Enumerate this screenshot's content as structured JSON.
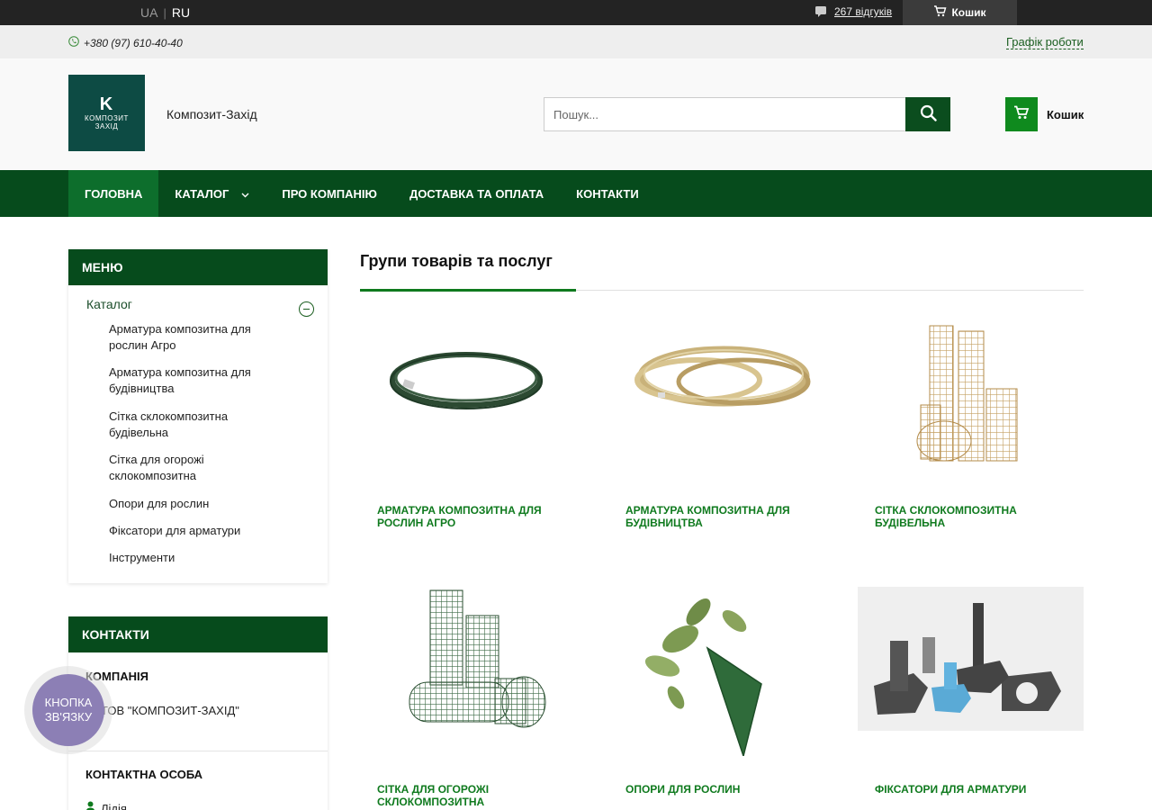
{
  "topbar": {
    "lang_ua": "UA",
    "lang_sep": "|",
    "lang_ru": "RU",
    "reviews": "267 відгуків",
    "cart": "Кошик"
  },
  "infobar": {
    "phone": "+380 (97) 610-40-40",
    "schedule": "Графік роботи"
  },
  "header": {
    "logo_letter": "K",
    "logo_line1": "КОМПОЗИТ",
    "logo_line2": "ЗАХІД",
    "company": "Композит-Захід",
    "search_placeholder": "Пошук...",
    "cart": "Кошик"
  },
  "nav": {
    "items": [
      {
        "label": "ГОЛОВНА",
        "active": true
      },
      {
        "label": "КАТАЛОГ",
        "dropdown": true
      },
      {
        "label": "ПРО КОМПАНІЮ"
      },
      {
        "label": "ДОСТАВКА ТА ОПЛАТА"
      },
      {
        "label": "КОНТАКТИ"
      }
    ]
  },
  "sidebar": {
    "menu_title": "МЕНЮ",
    "catalog": "Каталог",
    "items": [
      "Арматура композитна для рослин Агро",
      "Арматура композитна для будівництва",
      "Сітка склокомпозитна будівельна",
      "Сітка для огорожі склокомпозитна",
      "Опори для рослин",
      "Фіксатори для арматури",
      "Інструменти"
    ],
    "contacts_title": "КОНТАКТИ",
    "company_label": "КОМПАНІЯ",
    "company_name": "ТОВ \"КОМПОЗИТ-ЗАХІД\"",
    "person_label": "КОНТАКТНА ОСОБА",
    "person_name": "Лідія"
  },
  "float_button": {
    "line1": "КНОПКА",
    "line2": "ЗВ'ЯЗКУ"
  },
  "main": {
    "title": "Групи товарів та послуг",
    "groups": [
      "АРМАТУРА КОМПОЗИТНА ДЛЯ РОСЛИН АГРО",
      "АРМАТУРА КОМПОЗИТНА ДЛЯ БУДІВНИЦТВА",
      "СІТКА СКЛОКОМПОЗИТНА БУДІВЕЛЬНА",
      "СІТКА ДЛЯ ОГОРОЖІ СКЛОКОМПОЗИТНА",
      "ОПОРИ ДЛЯ РОСЛИН",
      "ФІКСАТОРИ ДЛЯ АРМАТУРИ"
    ]
  },
  "colors": {
    "nav_bg": "#064b1c",
    "nav_active": "#0d6e2c",
    "accent": "#0f7a1e",
    "topbar_bg": "#232323",
    "float_btn": "#8c7fb5"
  },
  "icons": {
    "reviews": "speech-bubble-icon",
    "topcart": "cart-icon",
    "phone": "phone-icon",
    "search": "search-icon",
    "cart": "cart-icon",
    "catalog_toggle": "minus-circle-icon",
    "person": "person-icon"
  }
}
